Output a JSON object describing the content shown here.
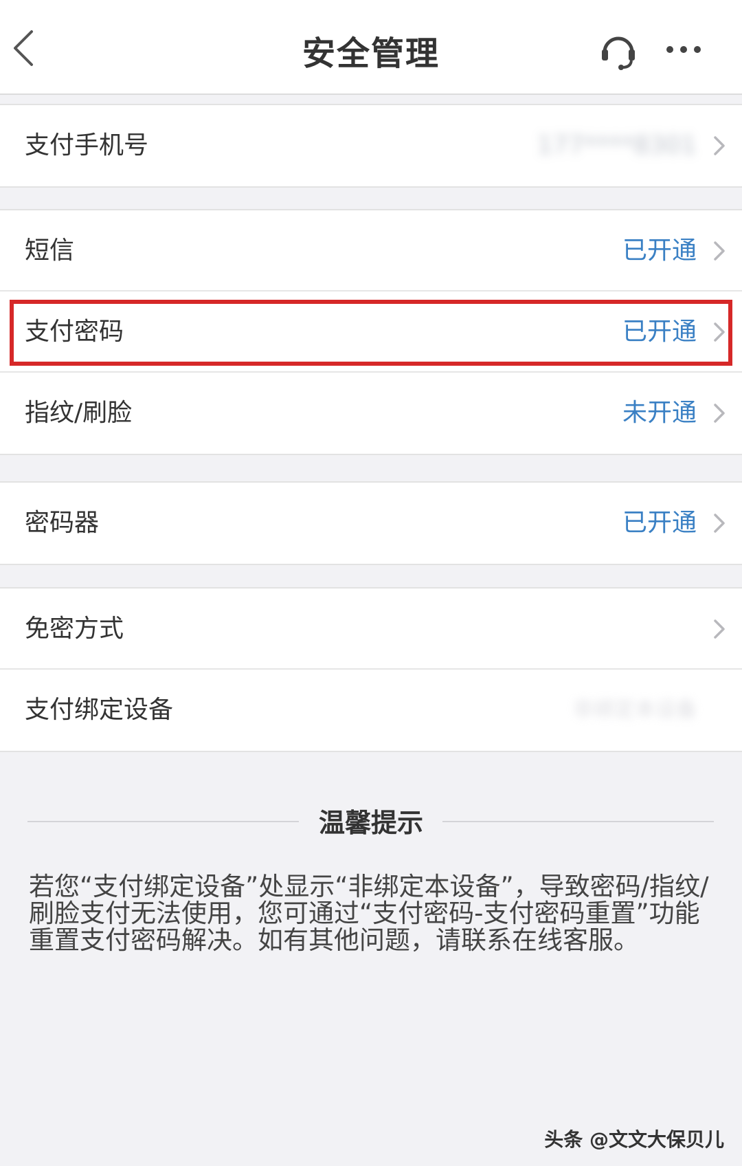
{
  "header": {
    "title": "安全管理",
    "back_icon": "chevron-left-icon",
    "support_icon": "headset-icon",
    "more_icon": "more-dots-icon"
  },
  "rows": {
    "pay_phone": {
      "label": "支付手机号",
      "value": "177****8301"
    },
    "sms": {
      "label": "短信",
      "value": "已开通"
    },
    "pay_password": {
      "label": "支付密码",
      "value": "已开通"
    },
    "biometric": {
      "label": "指纹/刷脸",
      "value": "未开通"
    },
    "token": {
      "label": "密码器",
      "value": "已开通"
    },
    "no_password": {
      "label": "免密方式",
      "value": ""
    },
    "bound_device": {
      "label": "支付绑定设备",
      "value": "非绑定本设备"
    }
  },
  "tip": {
    "title": "温馨提示",
    "body": "若您“支付绑定设备”处显示“非绑定本设备”，导致密码/指纹/刷脸支付无法使用，您可通过“支付密码-支付密码重置”功能重置支付密码解决。如有其他问题，请联系在线客服。"
  },
  "watermark": "头条 @文文大保贝儿",
  "colors": {
    "accent": "#3a80c4",
    "highlight": "#d62828",
    "background": "#f2f2f5"
  }
}
